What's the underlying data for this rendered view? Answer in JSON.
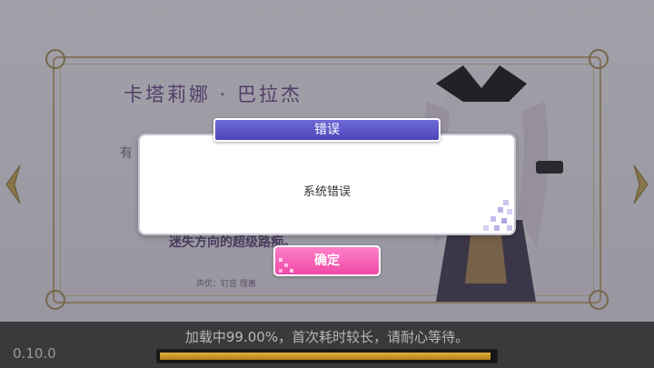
{
  "background": {
    "character_name": "卡塔莉娜 · 巴拉杰",
    "desc_line_1": "有",
    "desc_line_last": "迷失方向的超级路痴。",
    "cv_label": "声优：钉宫 理惠"
  },
  "dialog": {
    "title": "错误",
    "message": "系统错误",
    "confirm_label": "确定"
  },
  "loading": {
    "version": "0.10.0",
    "status_text": "加载中99.00%，首次耗时较长，请耐心等待。",
    "progress": 0.99
  },
  "colors": {
    "title_bar": "#4b45b8",
    "confirm_button": "#f04aa8",
    "progress_fill": "#e2b340",
    "bottom_bar": "#3a3a3c"
  },
  "icons": {
    "nav_left": "ornate-arrow-left-icon",
    "nav_right": "ornate-arrow-right-icon",
    "pixel_deco": "pixel-sparkle-icon"
  }
}
